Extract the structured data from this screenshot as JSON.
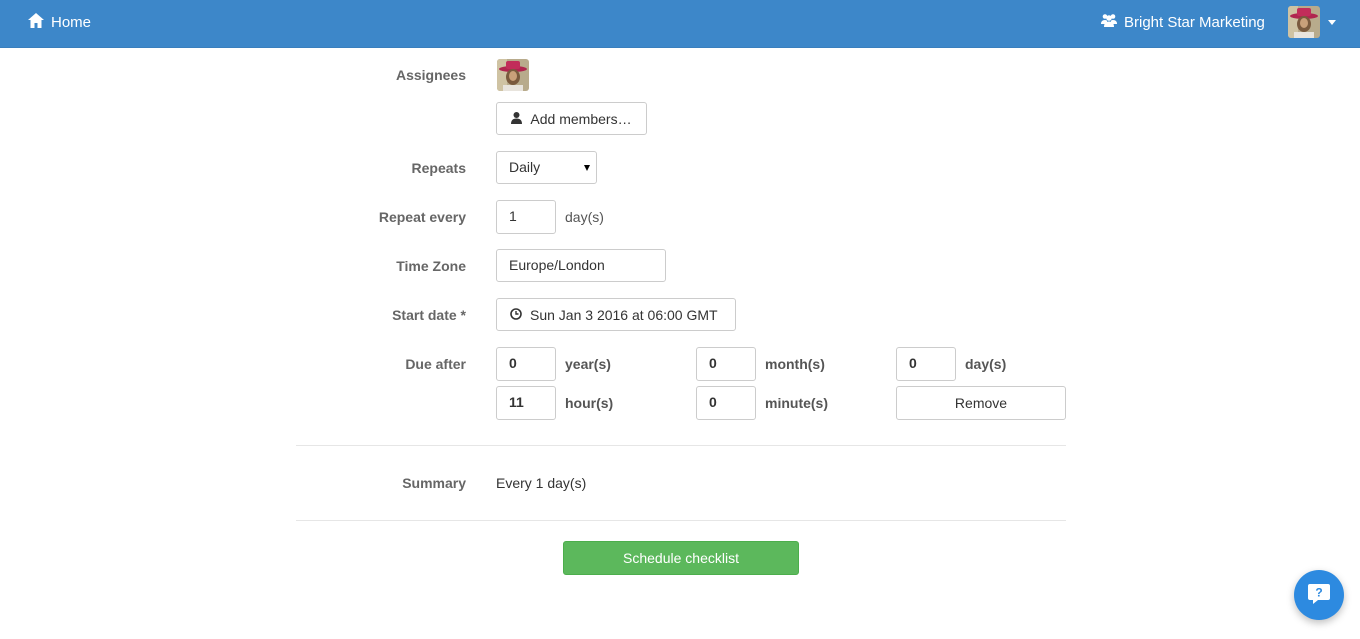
{
  "navbar": {
    "home_label": "Home",
    "org_label": "Bright Star Marketing",
    "home_icon": "home-icon",
    "org_icon": "users-icon",
    "user_menu_icon": "caret-down-icon"
  },
  "form": {
    "assignees": {
      "label": "Assignees",
      "add_button": "Add members…",
      "add_icon": "user-icon"
    },
    "repeats": {
      "label": "Repeats",
      "value": "Daily"
    },
    "repeat_every": {
      "label": "Repeat every",
      "value": "1",
      "unit": "day(s)"
    },
    "time_zone": {
      "label": "Time Zone",
      "value": "Europe/London"
    },
    "start_date": {
      "label": "Start date *",
      "value": "Sun Jan 3 2016 at 06:00 GMT",
      "icon": "clock-icon"
    },
    "due_after": {
      "label": "Due after",
      "years": {
        "value": "0",
        "unit": "year(s)"
      },
      "months": {
        "value": "0",
        "unit": "month(s)"
      },
      "days": {
        "value": "0",
        "unit": "day(s)"
      },
      "hours": {
        "value": "11",
        "unit": "hour(s)"
      },
      "minutes": {
        "value": "0",
        "unit": "minute(s)"
      },
      "remove_button": "Remove"
    },
    "summary": {
      "label": "Summary",
      "value": "Every 1 day(s)"
    },
    "submit_button": "Schedule checklist"
  },
  "colors": {
    "navbar": "#3d87c9",
    "success": "#5cb85c",
    "help": "#2d8ae0"
  },
  "help": {
    "icon": "help-chat-icon",
    "glyph": "?"
  }
}
